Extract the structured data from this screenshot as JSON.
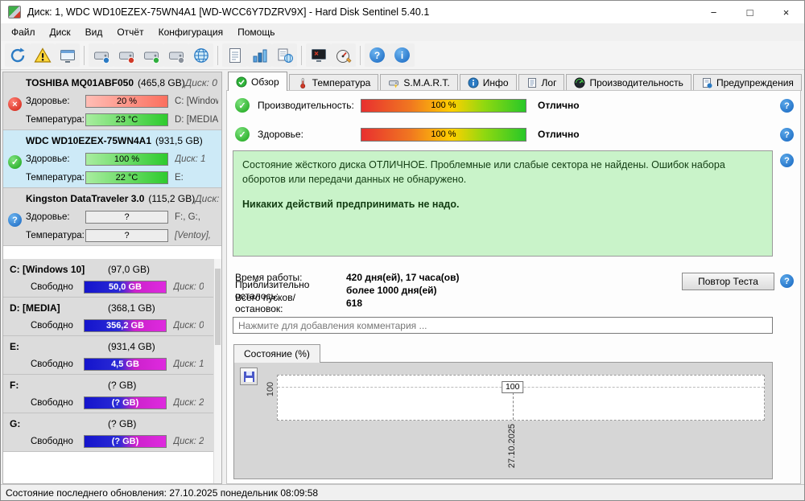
{
  "window": {
    "title": "Диск: 1, WDC WD10EZEX-75WN4A1 [WD-WCC6Y7DZRV9X]  -  Hard Disk Sentinel 5.40.1",
    "minimize_glyph": "−",
    "maximize_glyph": "□",
    "close_glyph": "×"
  },
  "glyphs": {
    "check": "✓",
    "cross": "×",
    "question": "?",
    "help": "?",
    "info": "i"
  },
  "menu": {
    "items": [
      "Файл",
      "Диск",
      "Вид",
      "Отчёт",
      "Конфигурация",
      "Помощь"
    ]
  },
  "toolbar": {
    "icons": [
      "refresh",
      "problem-report",
      "message-monitor",
      "disk-detect-blue",
      "disk-test-red",
      "disk-test-green",
      "disk-gray",
      "online-globe",
      "report-page",
      "statistics-bars",
      "online-report",
      "screen-test",
      "performance-gauge",
      "help",
      "about"
    ]
  },
  "sidebar": {
    "disks": [
      {
        "name": "TOSHIBA MQ01ABF050",
        "size": "(465,8 GB)",
        "disk": "Диск: 0",
        "health_label": "Здоровье:",
        "health": "20 %",
        "health_right": "C: [Window",
        "temp_label": "Температура:",
        "temp": "23 °C",
        "temp_right": "D: [MEDIA]"
      },
      {
        "name": "WDC WD10EZEX-75WN4A1",
        "size": "(931,5 GB)",
        "disk": "",
        "health_label": "Здоровье:",
        "health": "100 %",
        "health_right": "Диск: 1",
        "temp_label": "Температура:",
        "temp": "22 °C",
        "temp_right": "E:"
      },
      {
        "name": "Kingston DataTraveler 3.0",
        "size": "(115,2 GB)",
        "disk": "Диск:",
        "health_label": "Здоровье:",
        "health": "?",
        "health_right": "F:, G:,",
        "temp_label": "Температура:",
        "temp": "?",
        "temp_right": "[Ventoy],"
      }
    ],
    "partitions": [
      {
        "name": "C: [Windows 10]",
        "size": "(97,0 GB)",
        "free_label": "Свободно",
        "free": "50,0 GB",
        "disk": "Диск: 0"
      },
      {
        "name": "D: [MEDIA]",
        "size": "(368,1 GB)",
        "free_label": "Свободно",
        "free": "356,2 GB",
        "disk": "Диск: 0"
      },
      {
        "name": "E:",
        "size": "(931,4 GB)",
        "free_label": "Свободно",
        "free": "4,5 GB",
        "disk": "Диск: 1"
      },
      {
        "name": "F:",
        "size": "(? GB)",
        "free_label": "Свободно",
        "free": "(? GB)",
        "disk": "Диск: 2"
      },
      {
        "name": "G:",
        "size": "(? GB)",
        "free_label": "Свободно",
        "free": "(? GB)",
        "disk": "Диск: 2"
      }
    ]
  },
  "tabs": [
    "Обзор",
    "Температура",
    "S.M.A.R.T.",
    "Инфо",
    "Лог",
    "Производительность",
    "Предупреждения"
  ],
  "overview": {
    "performance_label": "Производительность:",
    "performance_value": "100 %",
    "performance_rating": "Отлично",
    "health_label": "Здоровье:",
    "health_value": "100 %",
    "health_rating": "Отлично",
    "status_text": "Состояние жёсткого диска ОТЛИЧНОЕ. Проблемные или слабые сектора не найдены. Ошибок набора оборотов или передачи данных не обнаружено.",
    "status_action": "Никаких действий предпринимать не надо.",
    "stats": [
      {
        "label": "Время работы:",
        "value": "420 дня(ей), 17 часа(ов)"
      },
      {
        "label": "Приблизительно осталось:",
        "value": "более 1000 дня(ей)"
      },
      {
        "label": "Всего пусков/остановок:",
        "value": "618"
      }
    ],
    "retest_button": "Повтор Теста",
    "comment_placeholder": "Нажмите для добавления комментария ..."
  },
  "chart_tab_label": "Состояние (%)",
  "chart_data": {
    "type": "line",
    "title": "Состояние (%)",
    "x": [
      "27.10.2025"
    ],
    "series": [
      {
        "name": "Состояние (%)",
        "values": [
          100
        ]
      }
    ],
    "ylim": [
      0,
      100
    ],
    "ytick_labels": [
      "100"
    ],
    "point_label": "100",
    "grid": "dashed",
    "legend": "none"
  },
  "statusbar": {
    "text": "Состояние последнего обновления: 27.10.2025 понедельник 08:09:58"
  }
}
